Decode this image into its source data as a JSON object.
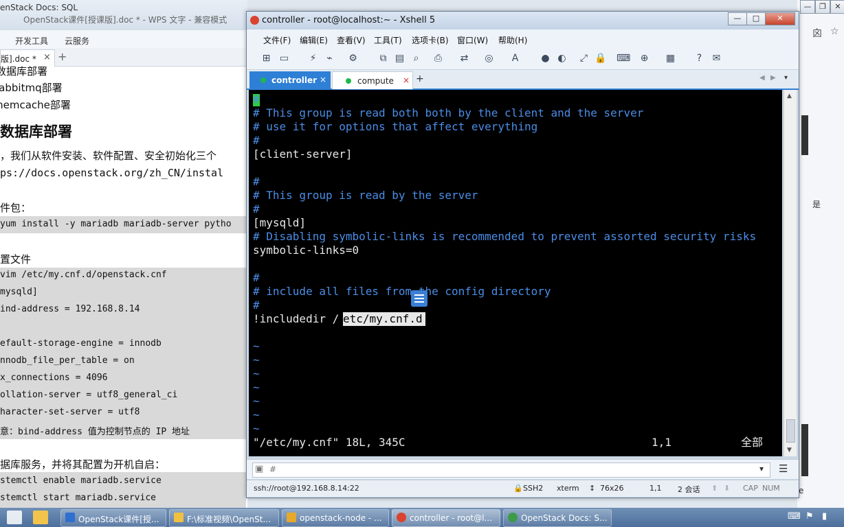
{
  "wps": {
    "tab_title": "enStack Docs: SQL",
    "app_title": "OpenStack课件[授课版].doc * - WPS 文字 - 兼容模式",
    "menu": [
      "开发工具",
      "云服务"
    ],
    "doc_tab": "版].doc *",
    "doc_tab_close": "×",
    "new_tab": "+",
    "content": {
      "list_items": [
        "数据库部署",
        "rabbitmq部署",
        "memcache部署"
      ],
      "heading": "数据库部署",
      "intro": "，我们从软件安装、软件配置、安全初始化三个",
      "url": "ps://docs.openstack.org/zh_CN/instal",
      "pkg_label": "件包：",
      "install_cmd": "yum install -y mariadb mariadb-server pytho",
      "config_label": "置文件",
      "config_lines": [
        "vim /etc/my.cnf.d/openstack.cnf",
        "mysqld]",
        "ind-address = 192.168.8.14",
        "",
        "efault-storage-engine = innodb",
        "nnodb_file_per_table = on",
        "x_connections = 4096",
        "ollation-server = utf8_general_ci",
        "haracter-set-server = utf8"
      ],
      "note": "意：bind-address 值为控制节点的 IP 地址",
      "service_label": "据库服务，并将其配置为开机自启：",
      "service_cmds": [
        "stemctl enable mariadb.service",
        "stemctl start mariadb.service"
      ]
    }
  },
  "right": {
    "min": "—",
    "restore": "❐",
    "close": "✕",
    "glyphs": [
      "囟",
      "☆",
      "是",
      "e"
    ]
  },
  "xshell": {
    "title": "controller - root@localhost:~ - Xshell 5",
    "win_min": "—",
    "win_max": "□",
    "win_close": "✕",
    "menu": [
      "文件(F)",
      "编辑(E)",
      "查看(V)",
      "工具(T)",
      "选项卡(B)",
      "窗口(W)",
      "帮助(H)"
    ],
    "tabs": [
      {
        "label": "controller",
        "close": "×",
        "active": true
      },
      {
        "label": "compute",
        "close": "×",
        "active": false
      }
    ],
    "new_tab": "+",
    "terminal": {
      "lines": [
        {
          "text": "#",
          "kind": "cmt"
        },
        {
          "text": "# This group is read both both by the client and the server",
          "kind": "cmt"
        },
        {
          "text": "# use it for options that affect everything",
          "kind": "cmt"
        },
        {
          "text": "#",
          "kind": "cmt"
        },
        {
          "text": "[client-server]",
          "kind": "wht"
        },
        {
          "text": "",
          "kind": "wht"
        },
        {
          "text": "#",
          "kind": "cmt"
        },
        {
          "text": "# This group is read by the server",
          "kind": "cmt"
        },
        {
          "text": "#",
          "kind": "cmt"
        },
        {
          "text": "[mysqld]",
          "kind": "wht"
        },
        {
          "text": "# Disabling symbolic-links is recommended to prevent assorted security risks",
          "kind": "cmt"
        },
        {
          "text": "symbolic-links=0",
          "kind": "wht"
        },
        {
          "text": "",
          "kind": "wht"
        },
        {
          "text": "#",
          "kind": "cmt"
        },
        {
          "text": "# include all files from the config directory",
          "kind": "cmt"
        },
        {
          "text": "#",
          "kind": "cmt"
        },
        {
          "text": "!includedir /",
          "kind": "wht"
        },
        {
          "text": "",
          "kind": "wht"
        },
        {
          "text": "~",
          "kind": "cmt"
        },
        {
          "text": "~",
          "kind": "cmt"
        },
        {
          "text": "~",
          "kind": "cmt"
        },
        {
          "text": "~",
          "kind": "cmt"
        },
        {
          "text": "~",
          "kind": "cmt"
        },
        {
          "text": "~",
          "kind": "cmt"
        },
        {
          "text": "~",
          "kind": "cmt"
        }
      ],
      "selected_text": "etc/my.cnf.d",
      "status_file": "\"/etc/my.cnf\" 18L, 345C",
      "status_pos": "1,1",
      "status_all": "全部"
    },
    "input_prompt_icon": "▣",
    "input_dropdown": "▾",
    "input_menu": "☰",
    "status": {
      "connection": "ssh://root@192.168.8.14:22",
      "protocol": "SSH2",
      "term": "xterm",
      "size": "76x26",
      "cursor": "1,1",
      "sessions": "2 会话",
      "caps": "CAP",
      "num": "NUM"
    }
  },
  "taskbar": {
    "items": [
      {
        "label": "OpenStack课件[授...",
        "color": "#2f6fd0"
      },
      {
        "label": "F:\\标准视频\\OpenSt...",
        "color": "#f0c040"
      },
      {
        "label": "openstack-node - ...",
        "color": "#e6a92b"
      },
      {
        "label": "controller - root@l...",
        "color": "#d9432f"
      },
      {
        "label": "OpenStack Docs: S...",
        "color": "#3c9b4a"
      }
    ]
  }
}
